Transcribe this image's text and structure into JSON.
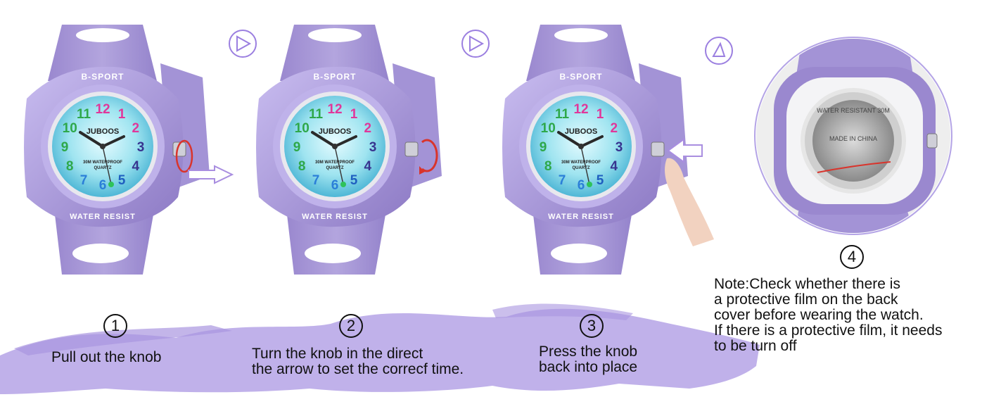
{
  "brand_text": "B-SPORT",
  "bezel_bottom_text": "WATER RESIST",
  "dial": {
    "brand": "JUBOOS",
    "sub_text_1": "30M WATERPROOF",
    "sub_text_2": "QUARTZ",
    "hour_numbers": [
      "12",
      "1",
      "2",
      "3",
      "4",
      "5",
      "6",
      "7",
      "8",
      "9",
      "10",
      "11"
    ]
  },
  "caseback_text": "WATER RESISTANT 30M",
  "caseback_text2": "MADE IN CHINA",
  "steps": [
    {
      "number": "1",
      "caption": "Pull out the knob"
    },
    {
      "number": "2",
      "caption": "Turn the knob in the direct\nthe arrow to set the correcf time."
    },
    {
      "number": "3",
      "caption": "Press the knob\nback into place"
    },
    {
      "number": "4",
      "caption": ""
    }
  ],
  "note": "Note:Check whether there is\na protective film on the back\ncover before wearing the watch.\nIf there is a protective film, it needs\nto be turn off",
  "colors": {
    "strap": "#a99ad6",
    "strap_dark": "#8e7cc5",
    "dial": "#9fe4f0",
    "brush": "#b6a6e6",
    "accent_arrow": "#a98ee0",
    "knob_circle": "#d9342c"
  }
}
